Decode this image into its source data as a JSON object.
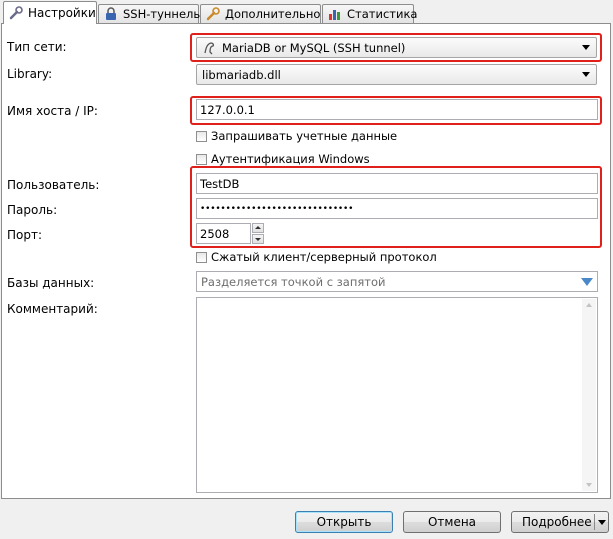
{
  "tabs": [
    {
      "label": "Настройки",
      "icon": "wrench-icon",
      "active": true
    },
    {
      "label": "SSH-туннель",
      "icon": "lock-icon",
      "active": false
    },
    {
      "label": "Дополнительно",
      "icon": "wrench-icon",
      "active": false
    },
    {
      "label": "Статистика",
      "icon": "bar-chart-icon",
      "active": false
    }
  ],
  "form": {
    "network_type": {
      "label": "Тип сети:",
      "value": "MariaDB or MySQL (SSH tunnel)",
      "icon": "dolphin-icon"
    },
    "library": {
      "label": "Library:",
      "value": "libmariadb.dll"
    },
    "host": {
      "label": "Имя хоста / IP:",
      "value": "127.0.0.1"
    },
    "ask_credentials": {
      "label": "Запрашивать учетные данные",
      "checked": false
    },
    "windows_auth": {
      "label": "Аутентификация Windows",
      "checked": false
    },
    "user": {
      "label": "Пользователь:",
      "value": "TestDB"
    },
    "password": {
      "label": "Пароль:",
      "value": "••••••••••••••••••••••••••••••"
    },
    "port": {
      "label": "Порт:",
      "value": "2508"
    },
    "compressed": {
      "label": "Сжатый клиент/серверный протокол",
      "checked": false
    },
    "databases": {
      "label": "Базы данных:",
      "placeholder": "Разделяется точкой с запятой"
    },
    "comment": {
      "label": "Комментарий:",
      "value": ""
    }
  },
  "buttons": {
    "open": "Открыть",
    "cancel": "Отмена",
    "more": "Подробнее"
  },
  "colors": {
    "highlight": "#e0201b",
    "accent": "#3c7fb1"
  }
}
